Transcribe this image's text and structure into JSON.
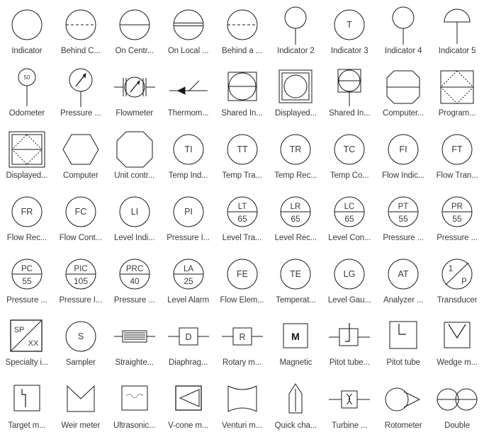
{
  "page": {
    "title": "P&ID Instrumentation Symbol Library",
    "columns": 9,
    "rows": 7,
    "stroke_color": "#1a1a1a",
    "label_color": "#3a3a3a",
    "background": "#ffffff"
  },
  "symbols": [
    {
      "id": "indicator",
      "label": "Indicator",
      "shape": "circle",
      "tag": "",
      "number": ""
    },
    {
      "id": "behind-control-panel",
      "label": "Behind C...",
      "shape": "circle-dashed-line",
      "tag": "",
      "number": ""
    },
    {
      "id": "on-central-panel",
      "label": "On Centr...",
      "shape": "circle-solid-line",
      "tag": "",
      "number": ""
    },
    {
      "id": "on-local-panel",
      "label": "On Local ...",
      "shape": "circle-double-line",
      "tag": "",
      "number": ""
    },
    {
      "id": "behind-a-panel",
      "label": "Behind a ...",
      "shape": "circle-dashed-line",
      "tag": "",
      "number": ""
    },
    {
      "id": "indicator-2",
      "label": "Indicator 2",
      "shape": "circle-stem",
      "tag": "",
      "number": ""
    },
    {
      "id": "indicator-3",
      "label": "Indicator 3",
      "shape": "circle-tag",
      "tag": "T",
      "number": ""
    },
    {
      "id": "indicator-4",
      "label": "Indicator 4",
      "shape": "circle-stem",
      "tag": "",
      "number": ""
    },
    {
      "id": "indicator-5",
      "label": "Indicator 5",
      "shape": "dome-stem",
      "tag": "",
      "number": ""
    },
    {
      "id": "odometer",
      "label": "Odometer",
      "shape": "small-circle-stem",
      "tag": "",
      "number": "50"
    },
    {
      "id": "pressure-gauge",
      "label": "Pressure ...",
      "shape": "gauge-stem",
      "tag": "",
      "number": ""
    },
    {
      "id": "flowmeter",
      "label": "Flowmeter",
      "shape": "gauge-inline",
      "tag": "",
      "number": ""
    },
    {
      "id": "thermometer",
      "label": "Thermom...",
      "shape": "thermometer",
      "tag": "",
      "number": ""
    },
    {
      "id": "shared-indicator",
      "label": "Shared In...",
      "shape": "square-circle-line",
      "tag": "",
      "number": ""
    },
    {
      "id": "displayed-shared",
      "label": "Displayed...",
      "shape": "dbl-square-circle",
      "tag": "",
      "number": ""
    },
    {
      "id": "shared-indicator-2",
      "label": "Shared In...",
      "shape": "square-circle-stem",
      "tag": "",
      "number": ""
    },
    {
      "id": "computer-function",
      "label": "Computer...",
      "shape": "octagon-line",
      "tag": "",
      "number": ""
    },
    {
      "id": "programmable-logic",
      "label": "Program...",
      "shape": "square-diamond-line",
      "tag": "",
      "number": ""
    },
    {
      "id": "displayed-plc",
      "label": "Displayed...",
      "shape": "dbl-square-diamond",
      "tag": "",
      "number": ""
    },
    {
      "id": "computer",
      "label": "Computer",
      "shape": "hexagon",
      "tag": "",
      "number": ""
    },
    {
      "id": "unit-control",
      "label": "Unit contr...",
      "shape": "octagon",
      "tag": "",
      "number": ""
    },
    {
      "id": "temp-indicator",
      "label": "Temp Ind...",
      "shape": "circle-tag",
      "tag": "TI",
      "number": ""
    },
    {
      "id": "temp-transmitter",
      "label": "Temp Tra...",
      "shape": "circle-tag",
      "tag": "TT",
      "number": ""
    },
    {
      "id": "temp-recorder",
      "label": "Temp Rec...",
      "shape": "circle-tag",
      "tag": "TR",
      "number": ""
    },
    {
      "id": "temp-controller",
      "label": "Temp Co...",
      "shape": "circle-tag",
      "tag": "TC",
      "number": ""
    },
    {
      "id": "flow-indicator",
      "label": "Flow Indic...",
      "shape": "circle-tag",
      "tag": "FI",
      "number": ""
    },
    {
      "id": "flow-transmitter",
      "label": "Flow Tran...",
      "shape": "circle-tag",
      "tag": "FT",
      "number": ""
    },
    {
      "id": "flow-recorder",
      "label": "Flow Rec...",
      "shape": "circle-tag",
      "tag": "FR",
      "number": ""
    },
    {
      "id": "flow-controller",
      "label": "Flow Cont...",
      "shape": "circle-tag",
      "tag": "FC",
      "number": ""
    },
    {
      "id": "level-indicator",
      "label": "Level Indi...",
      "shape": "circle-tag",
      "tag": "LI",
      "number": ""
    },
    {
      "id": "pressure-indicator",
      "label": "Pressure I...",
      "shape": "circle-tag",
      "tag": "PI",
      "number": ""
    },
    {
      "id": "level-transmitter",
      "label": "Level Tra...",
      "shape": "circle-tag-num",
      "tag": "LT",
      "number": "65"
    },
    {
      "id": "level-recorder",
      "label": "Level Rec...",
      "shape": "circle-tag-num",
      "tag": "LR",
      "number": "65"
    },
    {
      "id": "level-controller",
      "label": "Level Con...",
      "shape": "circle-tag-num",
      "tag": "LC",
      "number": "65"
    },
    {
      "id": "pressure-transmitter",
      "label": "Pressure ...",
      "shape": "circle-tag-num",
      "tag": "PT",
      "number": "55"
    },
    {
      "id": "pressure-recorder",
      "label": "Pressure ...",
      "shape": "circle-tag-num",
      "tag": "PR",
      "number": "55"
    },
    {
      "id": "pressure-controller",
      "label": "Pressure ...",
      "shape": "circle-tag-num",
      "tag": "PC",
      "number": "55"
    },
    {
      "id": "pressure-ind-ctrl",
      "label": "Pressure I...",
      "shape": "circle-tag-num",
      "tag": "PIC",
      "number": "105"
    },
    {
      "id": "pressure-rec-ctrl",
      "label": "Pressure ...",
      "shape": "circle-tag-num",
      "tag": "PRC",
      "number": "40"
    },
    {
      "id": "level-alarm",
      "label": "Level Alarm",
      "shape": "circle-tag-num",
      "tag": "LA",
      "number": "25"
    },
    {
      "id": "flow-element",
      "label": "Flow Elem...",
      "shape": "circle-tag",
      "tag": "FE",
      "number": ""
    },
    {
      "id": "temperature-element",
      "label": "Temperat...",
      "shape": "circle-tag",
      "tag": "TE",
      "number": ""
    },
    {
      "id": "level-gauge",
      "label": "Level Gau...",
      "shape": "circle-tag",
      "tag": "LG",
      "number": ""
    },
    {
      "id": "analyzer-transmitter",
      "label": "Analyzer ...",
      "shape": "circle-tag",
      "tag": "AT",
      "number": ""
    },
    {
      "id": "transducer",
      "label": "Transducer",
      "shape": "circle-diag-tags",
      "tag": "1",
      "number": "P"
    },
    {
      "id": "specialty-item",
      "label": "Specialty i...",
      "shape": "square-diag-tags",
      "tag": "SP",
      "number": "XX"
    },
    {
      "id": "sampler",
      "label": "Sampler",
      "shape": "circle-tag",
      "tag": "S",
      "number": ""
    },
    {
      "id": "straightener",
      "label": "Straighte...",
      "shape": "straightener",
      "tag": "",
      "number": ""
    },
    {
      "id": "diaphragm-meter",
      "label": "Diaphrag...",
      "shape": "inline-box-tag",
      "tag": "D",
      "number": ""
    },
    {
      "id": "rotary-meter",
      "label": "Rotary m...",
      "shape": "inline-box-tag",
      "tag": "R",
      "number": ""
    },
    {
      "id": "magnetic",
      "label": "Magnetic",
      "shape": "box-bold-tag",
      "tag": "M",
      "number": ""
    },
    {
      "id": "pitot-tube-inline",
      "label": "Pitot tube...",
      "shape": "pitot-inline",
      "tag": "",
      "number": ""
    },
    {
      "id": "pitot-tube",
      "label": "Pitot tube",
      "shape": "pitot-box",
      "tag": "",
      "number": ""
    },
    {
      "id": "wedge-meter",
      "label": "Wedge m...",
      "shape": "wedge-box",
      "tag": "",
      "number": ""
    },
    {
      "id": "target-meter",
      "label": "Target m...",
      "shape": "target-box",
      "tag": "",
      "number": ""
    },
    {
      "id": "weir-meter",
      "label": "Weir meter",
      "shape": "weir",
      "tag": "",
      "number": ""
    },
    {
      "id": "ultrasonic-meter",
      "label": "Ultrasonic...",
      "shape": "ultrasonic-box",
      "tag": "",
      "number": ""
    },
    {
      "id": "v-cone-meter",
      "label": "V-cone m...",
      "shape": "vcone-box",
      "tag": "",
      "number": ""
    },
    {
      "id": "venturi-meter",
      "label": "Venturi m...",
      "shape": "venturi",
      "tag": "",
      "number": ""
    },
    {
      "id": "quick-change",
      "label": "Quick cha...",
      "shape": "quick-change",
      "tag": "",
      "number": ""
    },
    {
      "id": "turbine-meter",
      "label": "Turbine ...",
      "shape": "turbine-inline",
      "tag": "",
      "number": ""
    },
    {
      "id": "rotometer",
      "label": "Rotometer",
      "shape": "rotometer",
      "tag": "",
      "number": ""
    },
    {
      "id": "double-meter",
      "label": "Double",
      "shape": "double-circle",
      "tag": "",
      "number": ""
    }
  ]
}
